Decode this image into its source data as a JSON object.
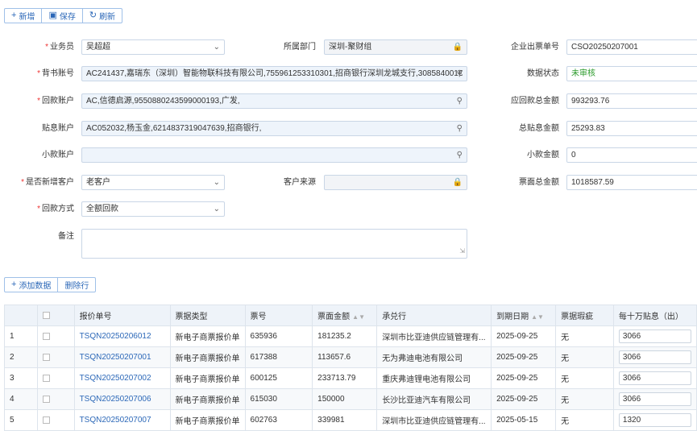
{
  "toolbar": {
    "add": "新增",
    "save": "保存",
    "refresh": "刷新"
  },
  "form": {
    "salesman": {
      "label": "业务员",
      "value": "吴超超"
    },
    "department": {
      "label": "所属部门",
      "value": "深圳-聚财组"
    },
    "invoice_no": {
      "label": "企业出票单号",
      "value": "CSO20250207001"
    },
    "endorse_account": {
      "label": "背书账号",
      "value": "AC241437,嘉瑞东（深圳）智能物联科技有限公司,755961253310301,招商银行深圳龙城支行,308584001€"
    },
    "data_status": {
      "label": "数据状态",
      "value": "未审核"
    },
    "payback_account": {
      "label": "回款账户",
      "value": "AC,信德启源,9550880243599000193,广发,"
    },
    "receivable_total": {
      "label": "应回款总金额",
      "value": "993293.76"
    },
    "discount_account": {
      "label": "贴息账户",
      "value": "AC052032,杨玉金,6214837319047639,招商银行,"
    },
    "discount_total": {
      "label": "总贴息金额",
      "value": "25293.83"
    },
    "small_account": {
      "label": "小款账户",
      "value": ""
    },
    "small_amount": {
      "label": "小款金额",
      "value": "0"
    },
    "new_customer": {
      "label": "是否新增客户",
      "value": "老客户"
    },
    "customer_source": {
      "label": "客户来源",
      "value": ""
    },
    "face_total": {
      "label": "票面总金额",
      "value": "1018587.59"
    },
    "payback_method": {
      "label": "回款方式",
      "value": "全额回款"
    },
    "remark": {
      "label": "备注",
      "value": ""
    }
  },
  "table_toolbar": {
    "add_data": "添加数据",
    "delete_row": "删除行"
  },
  "table": {
    "headers": {
      "quote_no": "报价单号",
      "bill_type": "票据类型",
      "bill_no": "票号",
      "face_amount": "票面金额",
      "acceptor": "承兑行",
      "due_date": "到期日期",
      "defect": "票据瑕疵",
      "discount": "每十万贴息（出）"
    },
    "rows": [
      {
        "idx": "1",
        "quote_no": "TSQN20250206012",
        "bill_type": "新电子商票报价单",
        "bill_no": "635936",
        "face_amount": "181235.2",
        "acceptor": "深圳市比亚迪供应链管理有...",
        "due_date": "2025-09-25",
        "defect": "无",
        "discount": "3066"
      },
      {
        "idx": "2",
        "quote_no": "TSQN20250207001",
        "bill_type": "新电子商票报价单",
        "bill_no": "617388",
        "face_amount": "113657.6",
        "acceptor": "无为弗迪电池有限公司",
        "due_date": "2025-09-25",
        "defect": "无",
        "discount": "3066"
      },
      {
        "idx": "3",
        "quote_no": "TSQN20250207002",
        "bill_type": "新电子商票报价单",
        "bill_no": "600125",
        "face_amount": "233713.79",
        "acceptor": "重庆弗迪锂电池有限公司",
        "due_date": "2025-09-25",
        "defect": "无",
        "discount": "3066"
      },
      {
        "idx": "4",
        "quote_no": "TSQN20250207006",
        "bill_type": "新电子商票报价单",
        "bill_no": "615030",
        "face_amount": "150000",
        "acceptor": "长沙比亚迪汽车有限公司",
        "due_date": "2025-09-25",
        "defect": "无",
        "discount": "3066"
      },
      {
        "idx": "5",
        "quote_no": "TSQN20250207007",
        "bill_type": "新电子商票报价单",
        "bill_no": "602763",
        "face_amount": "339981",
        "acceptor": "深圳市比亚迪供应链管理有...",
        "due_date": "2025-05-15",
        "defect": "无",
        "discount": "1320"
      }
    ]
  },
  "colors": {
    "accent": "#2c68b8",
    "required": "#e33333",
    "status_green": "#2a9a2a"
  }
}
